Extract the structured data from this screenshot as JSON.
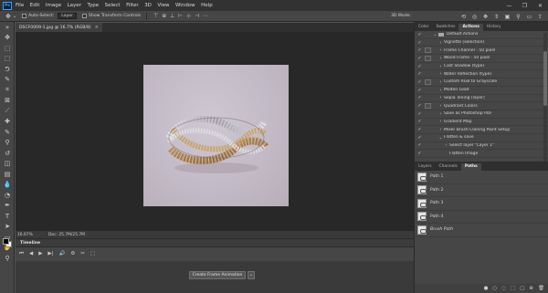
{
  "app": {
    "logo_text": "Ps",
    "menu": [
      "File",
      "Edit",
      "Image",
      "Layer",
      "Type",
      "Select",
      "Filter",
      "3D",
      "View",
      "Window",
      "Help"
    ],
    "window_controls": [
      "—",
      "❐",
      "✕"
    ]
  },
  "options_bar": {
    "auto_select_label": "Auto-Select:",
    "auto_select_value": "Layer",
    "transform_label": "Show Transform Controls",
    "mode_3d_label": "3D Mode:"
  },
  "document": {
    "tab_title": "DSCF0009-1.jpg @ 16.7% (RGB/8)",
    "tab_close": "×",
    "zoom": "16.67%",
    "doc_info": "Doc: 25.7M/25.7M"
  },
  "timeline": {
    "title": "Timeline",
    "create_button": "Create Frame Animation",
    "controls": [
      "⏮",
      "◀",
      "▶",
      "▶|",
      "🔊",
      "⚙",
      "✂",
      "⬚"
    ]
  },
  "right_panel": {
    "tabs": [
      {
        "label": "Color",
        "active": false
      },
      {
        "label": "Swatches",
        "active": false
      },
      {
        "label": "Actions",
        "active": true
      },
      {
        "label": "History",
        "active": false
      }
    ],
    "actions": [
      {
        "label": "Default Actions",
        "checked": true,
        "dialog": false,
        "arrow": "⌄",
        "folder": true,
        "indent": 0
      },
      {
        "label": "Vignette (selection)",
        "checked": true,
        "dialog": false,
        "arrow": "›",
        "folder": false,
        "indent": 1
      },
      {
        "label": "Frame Channel - 50 pixel",
        "checked": true,
        "dialog": true,
        "arrow": "›",
        "folder": false,
        "indent": 1
      },
      {
        "label": "Wood Frame - 50 pixel",
        "checked": true,
        "dialog": true,
        "arrow": "›",
        "folder": false,
        "indent": 1
      },
      {
        "label": "Cast Shadow (type)",
        "checked": true,
        "dialog": false,
        "arrow": "›",
        "folder": false,
        "indent": 1
      },
      {
        "label": "Water Reflection (type)",
        "checked": true,
        "dialog": false,
        "arrow": "›",
        "folder": false,
        "indent": 1
      },
      {
        "label": "Custom RGB to Grayscale",
        "checked": true,
        "dialog": true,
        "arrow": "›",
        "folder": false,
        "indent": 1
      },
      {
        "label": "Molten Lead",
        "checked": true,
        "dialog": false,
        "arrow": "›",
        "folder": false,
        "indent": 1
      },
      {
        "label": "Sepia Toning (layer)",
        "checked": true,
        "dialog": false,
        "arrow": "›",
        "folder": false,
        "indent": 1
      },
      {
        "label": "Quadrant Colors",
        "checked": true,
        "dialog": true,
        "arrow": "›",
        "folder": false,
        "indent": 1
      },
      {
        "label": "Save as Photoshop PDF",
        "checked": true,
        "dialog": false,
        "arrow": "›",
        "folder": false,
        "indent": 1
      },
      {
        "label": "Gradient Map",
        "checked": true,
        "dialog": false,
        "arrow": "›",
        "folder": false,
        "indent": 1
      },
      {
        "label": "Mixer Brush Cloning Paint Setup",
        "checked": true,
        "dialog": false,
        "arrow": "›",
        "folder": false,
        "indent": 1
      },
      {
        "label": "Flatten & save",
        "checked": true,
        "dialog": false,
        "arrow": "⌄",
        "folder": false,
        "indent": 1
      },
      {
        "label": "Select layer \"Layer 1\"",
        "checked": true,
        "dialog": false,
        "arrow": "›",
        "folder": false,
        "indent": 2
      },
      {
        "label": "Flatten Image",
        "checked": true,
        "dialog": false,
        "arrow": "",
        "folder": false,
        "indent": 2
      }
    ],
    "actions_footer": [
      "■",
      "●",
      "▶",
      "▬",
      "⊕",
      "🗑"
    ]
  },
  "paths_panel": {
    "tabs": [
      {
        "label": "Layers",
        "active": false
      },
      {
        "label": "Channels",
        "active": false
      },
      {
        "label": "Paths",
        "active": true
      }
    ],
    "items": [
      {
        "label": "Path 1",
        "italic": false
      },
      {
        "label": "Path 2",
        "italic": false
      },
      {
        "label": "Path 3",
        "italic": false
      },
      {
        "label": "Path 4",
        "italic": false
      },
      {
        "label": "Brush Path",
        "italic": true
      }
    ],
    "footer": [
      "●",
      "○",
      "◌",
      "⬚",
      "▢",
      "⊕",
      "🗑"
    ]
  },
  "tools": [
    {
      "name": "move-tool-icon",
      "glyph": "✥"
    },
    {
      "name": "artboard-tool-icon",
      "glyph": "⬚"
    },
    {
      "name": "marquee-tool-icon",
      "glyph": "⬚"
    },
    {
      "name": "lasso-tool-icon",
      "glyph": "ᕤ"
    },
    {
      "name": "quick-select-tool-icon",
      "glyph": "✎"
    },
    {
      "name": "crop-tool-icon",
      "glyph": "⌗"
    },
    {
      "name": "frame-tool-icon",
      "glyph": "⊠"
    },
    {
      "name": "eyedropper-tool-icon",
      "glyph": "⟋"
    },
    {
      "name": "healing-brush-tool-icon",
      "glyph": "✚"
    },
    {
      "name": "brush-tool-icon",
      "glyph": "✎"
    },
    {
      "name": "clone-stamp-tool-icon",
      "glyph": "⚲"
    },
    {
      "name": "history-brush-tool-icon",
      "glyph": "↺"
    },
    {
      "name": "eraser-tool-icon",
      "glyph": "◫"
    },
    {
      "name": "gradient-tool-icon",
      "glyph": "▤"
    },
    {
      "name": "blur-tool-icon",
      "glyph": "💧"
    },
    {
      "name": "dodge-tool-icon",
      "glyph": "◔"
    },
    {
      "name": "pen-tool-icon",
      "glyph": "✒"
    },
    {
      "name": "type-tool-icon",
      "glyph": "T"
    },
    {
      "name": "path-select-tool-icon",
      "glyph": "➤"
    },
    {
      "name": "rectangle-tool-icon",
      "glyph": "▭"
    },
    {
      "name": "hand-tool-icon",
      "glyph": "✋"
    },
    {
      "name": "zoom-tool-icon",
      "glyph": "⚲"
    }
  ]
}
